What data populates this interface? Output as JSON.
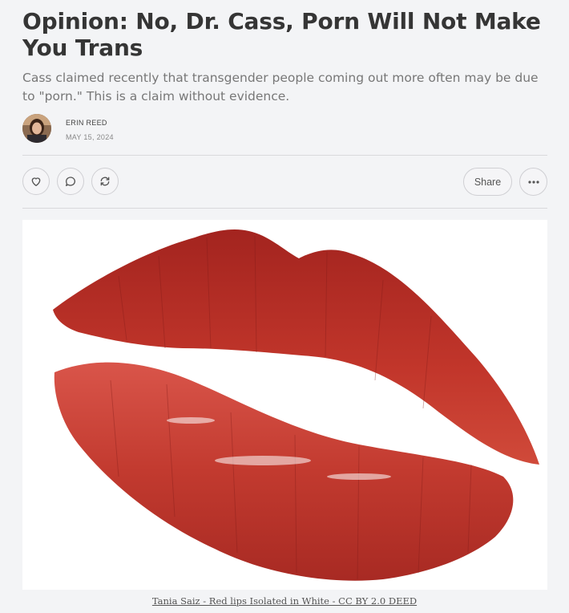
{
  "article": {
    "title": "Opinion: No, Dr. Cass, Porn Will Not Make You Trans",
    "subtitle": "Cass claimed recently that transgender people coming out more often may be due to \"porn.\" This is a claim without evidence.",
    "author": "ERIN REED",
    "date": "MAY 15, 2024"
  },
  "actions": {
    "share_label": "Share",
    "icons": [
      "heart-icon",
      "comment-icon",
      "restack-icon",
      "more-icon"
    ]
  },
  "image": {
    "caption": "Tania Saiz - Red lips Isolated in White - CC BY 2.0 DEED"
  },
  "colors": {
    "background": "#f3f4f6",
    "lips_red": "#c0342a",
    "lips_dark": "#8e1f1c"
  }
}
